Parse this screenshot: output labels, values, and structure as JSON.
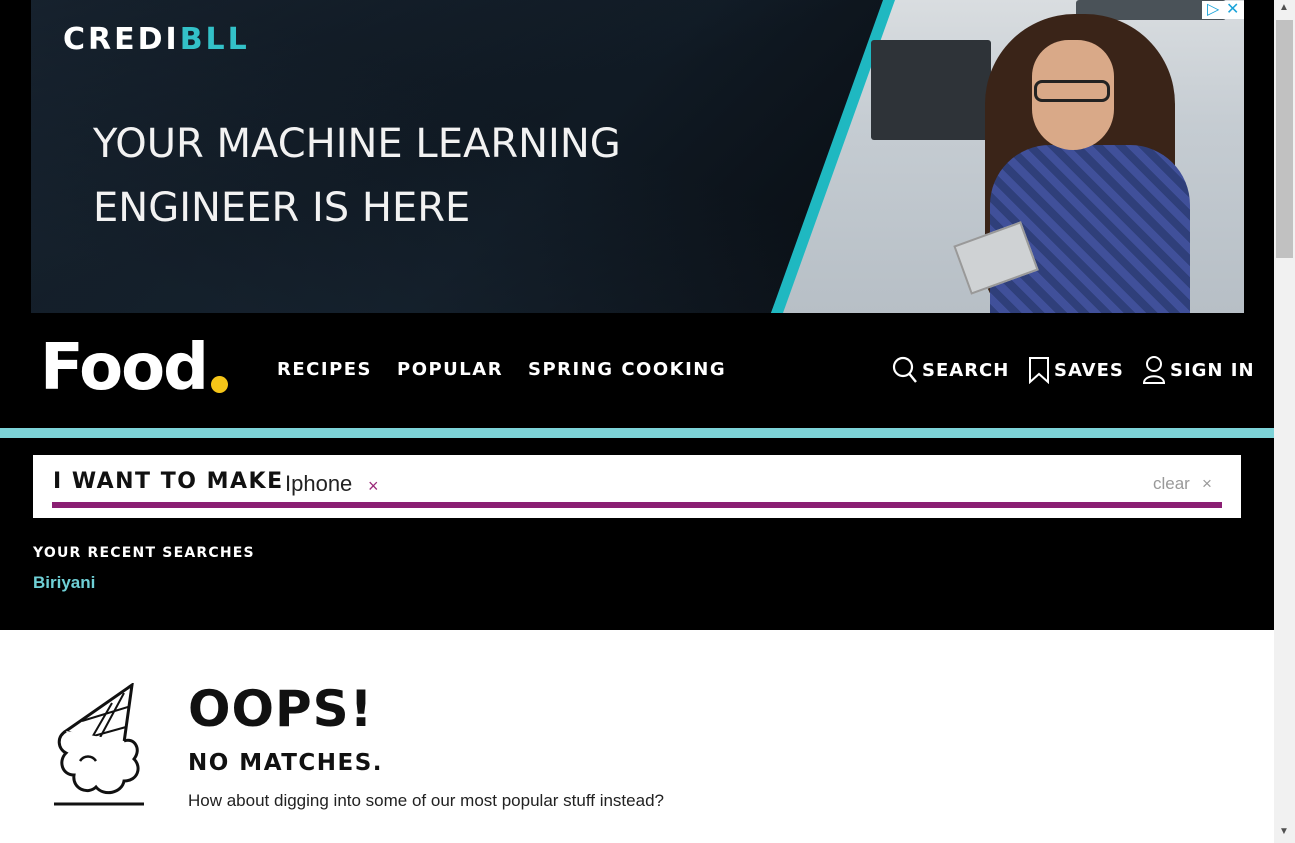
{
  "ad": {
    "brand_prefix": "CREDI",
    "brand_suffix": "BLL",
    "headline_line1": "YOUR MACHINE LEARNING",
    "headline_line2": "ENGINEER IS HERE",
    "adchoices_icon": "play-triangle-icon",
    "close_icon": "close-icon"
  },
  "header": {
    "logo": "Food",
    "nav": [
      "RECIPES",
      "POPULAR",
      "SPRING COOKING"
    ],
    "actions": {
      "search": "SEARCH",
      "saves": "SAVES",
      "sign_in": "SIGN IN"
    }
  },
  "search": {
    "label": "I WANT TO MAKE",
    "tag": "Iphone",
    "tag_remove": "×",
    "clear": "clear",
    "clear_x": "×"
  },
  "recent": {
    "heading": "YOUR RECENT SEARCHES",
    "items": [
      "Biriyani"
    ]
  },
  "results": {
    "title": "OOPS!",
    "subtitle": "NO MATCHES.",
    "message": "How about digging into some of our most popular stuff instead?"
  },
  "colors": {
    "teal": "#7dd3d8",
    "purple": "#8b1f73",
    "logo_dot": "#f5c518",
    "link": "#6fd0d6"
  }
}
